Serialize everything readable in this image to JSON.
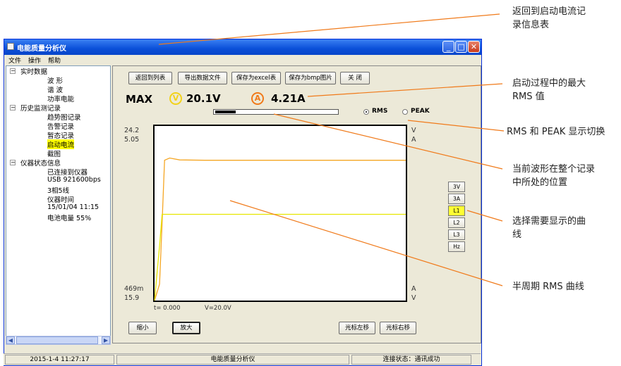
{
  "window": {
    "title": "电能质量分析仪"
  },
  "menu": [
    "文件",
    "操作",
    "帮助"
  ],
  "tree": {
    "realtime": {
      "label": "实时数据",
      "children": [
        "波 形",
        "谐 波",
        "功率电能"
      ]
    },
    "history": {
      "label": "历史监测记录",
      "children": [
        "趋势图记录",
        "告警记录",
        "暂态记录",
        "启动电流",
        "截图"
      ],
      "selected": "启动电流"
    },
    "device": {
      "label": "仪器状态信息",
      "children": [
        "已连接到仪器",
        "USB 921600bps",
        "3相5线",
        "仪器时间",
        "15/01/04 11:15",
        "电池电量 55%"
      ]
    }
  },
  "toolbar": {
    "back_to_list": "返回到列表",
    "export": "导出数据文件",
    "save_excel": "保存为excel表",
    "save_bmp": "保存为bmp图片",
    "close": "关 闭"
  },
  "readout": {
    "max_label": "MAX",
    "v_badge": "V",
    "v_value": "20.1V",
    "a_badge": "A",
    "a_value": "4.21A"
  },
  "position": {
    "fraction": 0.17
  },
  "mode": {
    "rms": "RMS",
    "peak": "PEAK",
    "selected": "RMS"
  },
  "chart_labels": {
    "v_top": "24.2",
    "a_top": "5.05",
    "a_bottom": "469m",
    "v_bottom": "15.9",
    "right_v_top": "V",
    "right_a_top": "A",
    "right_a_bottom": "A",
    "right_v_bottom": "V",
    "cursor_t": "t= 0.000",
    "cursor_v": "V=20.0V"
  },
  "chart_data": {
    "type": "line",
    "series": [
      {
        "color": "#f5a623",
        "axis": "A",
        "x": [
          0.0,
          0.02,
          0.03,
          0.04,
          0.06,
          0.1,
          0.2,
          1.0
        ],
        "values": [
          0.47,
          0.9,
          2.5,
          4.15,
          4.21,
          4.16,
          4.15,
          4.15
        ]
      },
      {
        "color": "#e6e600",
        "axis": "V",
        "x": [
          0.0,
          0.02,
          0.03,
          1.0
        ],
        "values": [
          15.9,
          18.5,
          20.0,
          20.0
        ]
      }
    ],
    "ylim_v": [
      15.9,
      24.2
    ],
    "ylim_a": [
      0.469,
      5.05
    ],
    "grid": false
  },
  "curve_select": {
    "buttons": [
      "3V",
      "3A",
      "L1",
      "L2",
      "L3",
      "Hz"
    ],
    "selected": "L1"
  },
  "bottom_buttons": {
    "zoom_out": "缩小",
    "zoom_in": "放大",
    "cursor_left": "光标左移",
    "cursor_right": "光标右移"
  },
  "statusbar": {
    "datetime": "2015-1-4 11:27:17",
    "app": "电能质量分析仪",
    "conn": "连接状态：通讯成功"
  },
  "annotations": {
    "a1": "返回到启动电流记录信息表",
    "a1_l1": "返回到启动电流记",
    "a1_l2": "录信息表",
    "a2_l1": "启动过程中的最大",
    "a2_l2": "RMS 值",
    "a3": "RMS 和 PEAK 显示切换",
    "a4_l1": "当前波形在整个记录",
    "a4_l2": "中所处的位置",
    "a5_l1": "选择需要显示的曲",
    "a5_l2": "线",
    "a6": "半周期 RMS 曲线"
  },
  "colors": {
    "accent": "#f07a1a",
    "voltage": "#e6e600",
    "current": "#f5a623"
  }
}
